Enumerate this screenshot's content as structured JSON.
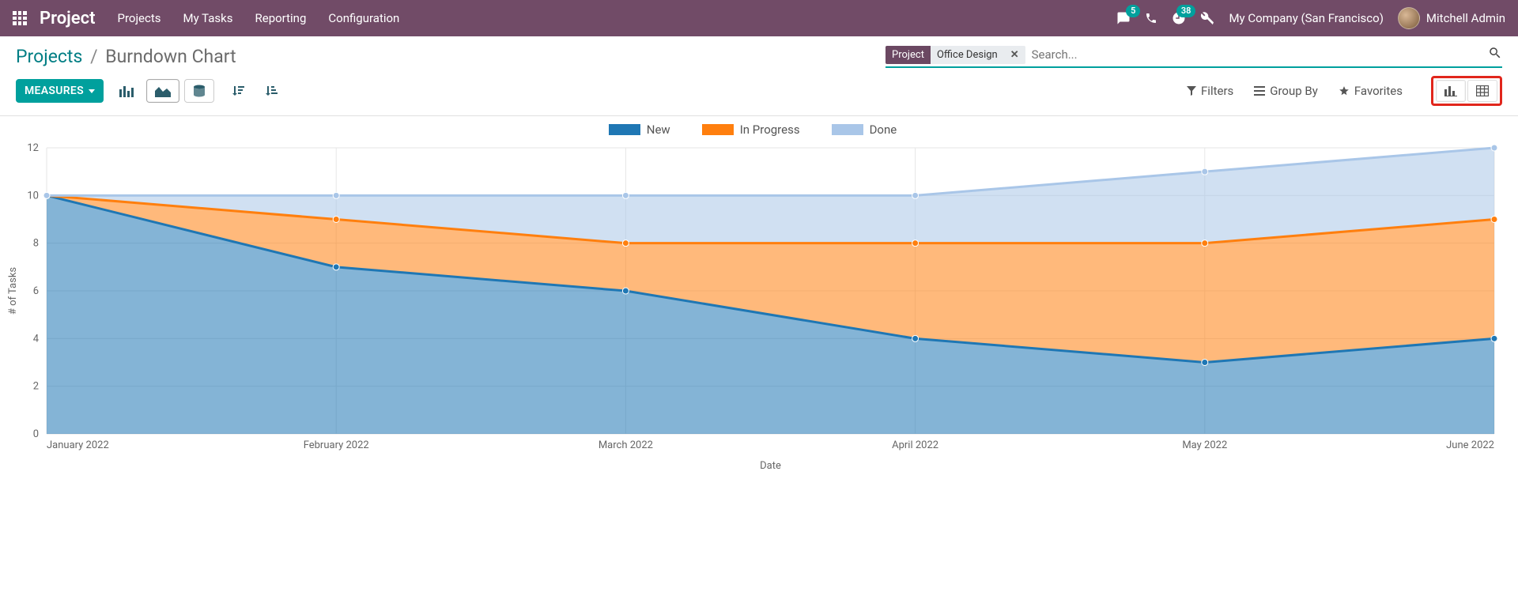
{
  "nav": {
    "brand": "Project",
    "menus": [
      "Projects",
      "My Tasks",
      "Reporting",
      "Configuration"
    ],
    "messages_badge": "5",
    "activities_badge": "38",
    "company": "My Company (San Francisco)",
    "user": "Mitchell Admin"
  },
  "breadcrumb": {
    "parent": "Projects",
    "current": "Burndown Chart"
  },
  "search": {
    "facet_label": "Project",
    "facet_value": "Office Design",
    "placeholder": "Search..."
  },
  "toolbar": {
    "measures_label": "Measures",
    "filters_label": "Filters",
    "groupby_label": "Group By",
    "favorites_label": "Favorites"
  },
  "chart_ui": {
    "legend": [
      "New",
      "In Progress",
      "Done"
    ],
    "colors": {
      "new": "#1f77b4",
      "in_progress": "#ff7f0e",
      "done": "#a9c6e8"
    },
    "xlabel": "Date",
    "ylabel": "# of Tasks"
  },
  "chart_data": {
    "type": "area",
    "stacked": true,
    "xlabel": "Date",
    "ylabel": "# of Tasks",
    "title": "",
    "ylim": [
      0,
      12
    ],
    "categories": [
      "January 2022",
      "February 2022",
      "March 2022",
      "April 2022",
      "May 2022",
      "June 2022"
    ],
    "series": [
      {
        "name": "New",
        "values": [
          10,
          7,
          6,
          4,
          3,
          4
        ],
        "cumulative": [
          10,
          7,
          6,
          4,
          3,
          4
        ]
      },
      {
        "name": "In Progress",
        "values": [
          0,
          2,
          2,
          4,
          5,
          5
        ],
        "cumulative": [
          10,
          9,
          8,
          8,
          8,
          9
        ]
      },
      {
        "name": "Done",
        "values": [
          0,
          1,
          2,
          2,
          3,
          3
        ],
        "cumulative": [
          10,
          10,
          10,
          10,
          11,
          12
        ]
      }
    ]
  }
}
